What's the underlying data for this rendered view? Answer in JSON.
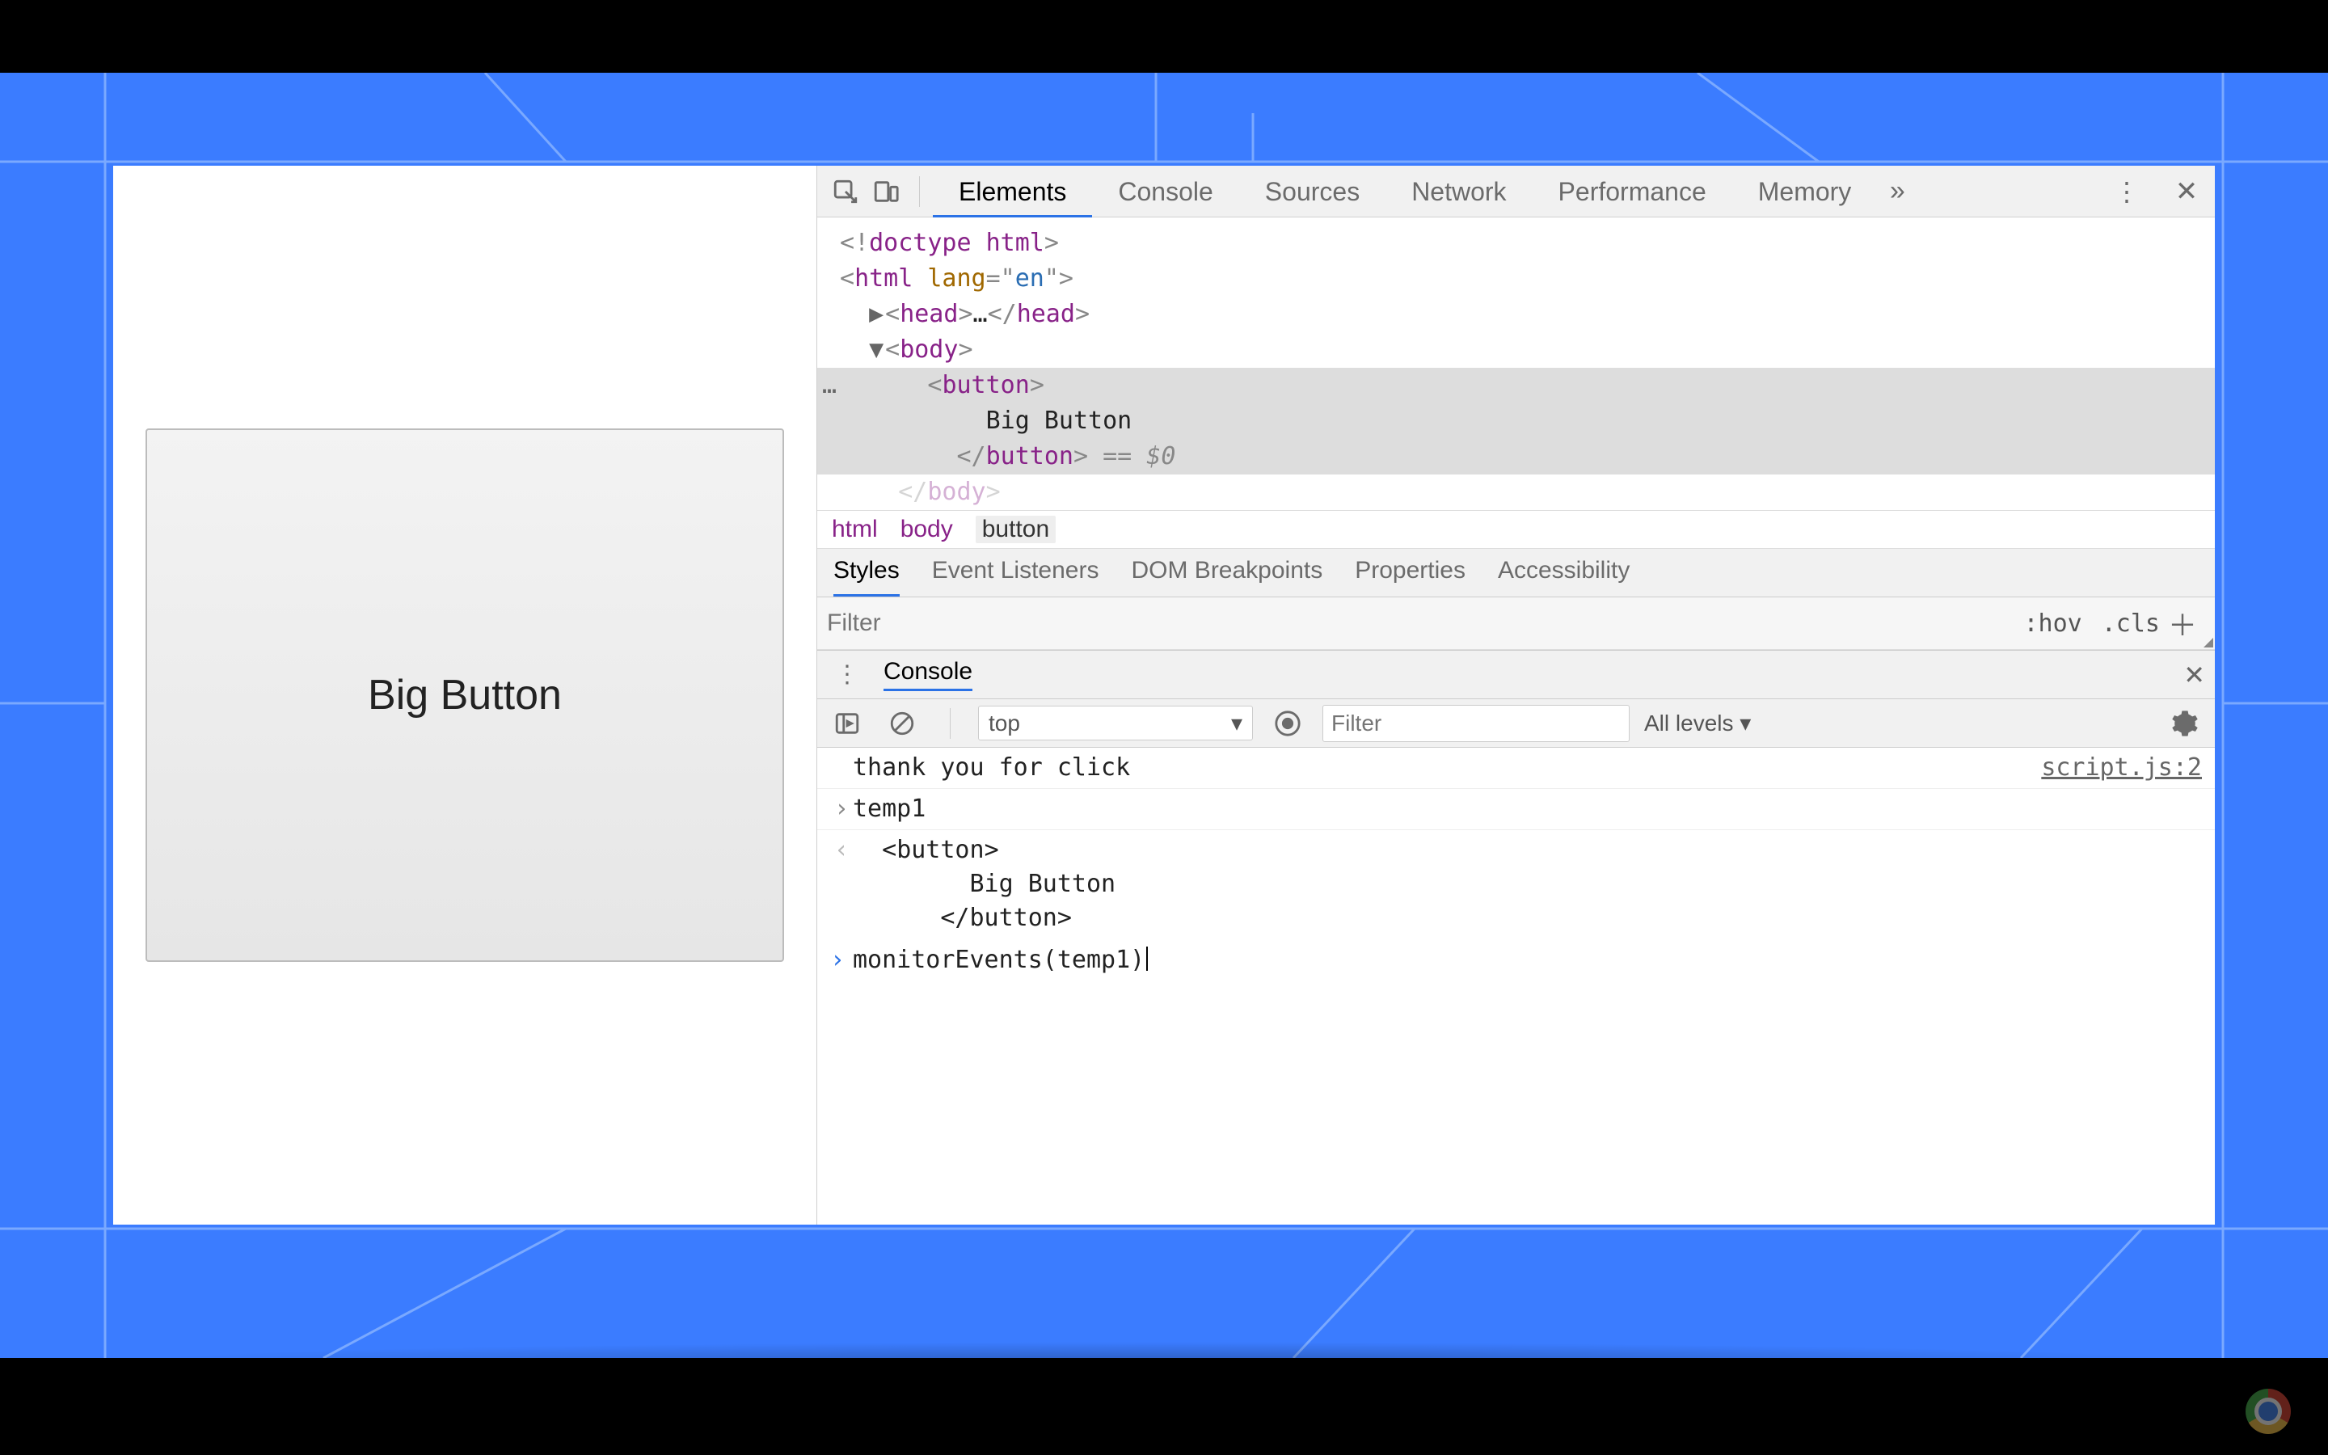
{
  "page": {
    "bigButtonLabel": "Big Button"
  },
  "devtools": {
    "tabs": [
      "Elements",
      "Console",
      "Sources",
      "Network",
      "Performance",
      "Memory"
    ],
    "activeTab": "Elements",
    "dom": {
      "doctype": "<!doctype html>",
      "htmlOpen": "<html lang=\"en\">",
      "headCollapsed": "<head>…</head>",
      "bodyOpen": "<body>",
      "buttonOpen": "<button>",
      "buttonText": "Big Button",
      "buttonClose": "</button>",
      "selRef": "== $0",
      "bodyClose": "</body>"
    },
    "breadcrumb": [
      "html",
      "body",
      "button"
    ],
    "subtabs": [
      "Styles",
      "Event Listeners",
      "DOM Breakpoints",
      "Properties",
      "Accessibility"
    ],
    "activeSubtab": "Styles",
    "styles": {
      "filterPlaceholder": "Filter",
      "hov": ":hov",
      "cls": ".cls"
    }
  },
  "console": {
    "title": "Console",
    "context": "top",
    "filterPlaceholder": "Filter",
    "levels": "All levels ▾",
    "log1": {
      "text": "thank you for click",
      "src": "script.js:2"
    },
    "entry1": {
      "prompt": "temp1"
    },
    "result1": {
      "line1": "<button>",
      "line2": "Big Button",
      "line3": "</button>"
    },
    "input": "monitorEvents(temp1)"
  }
}
